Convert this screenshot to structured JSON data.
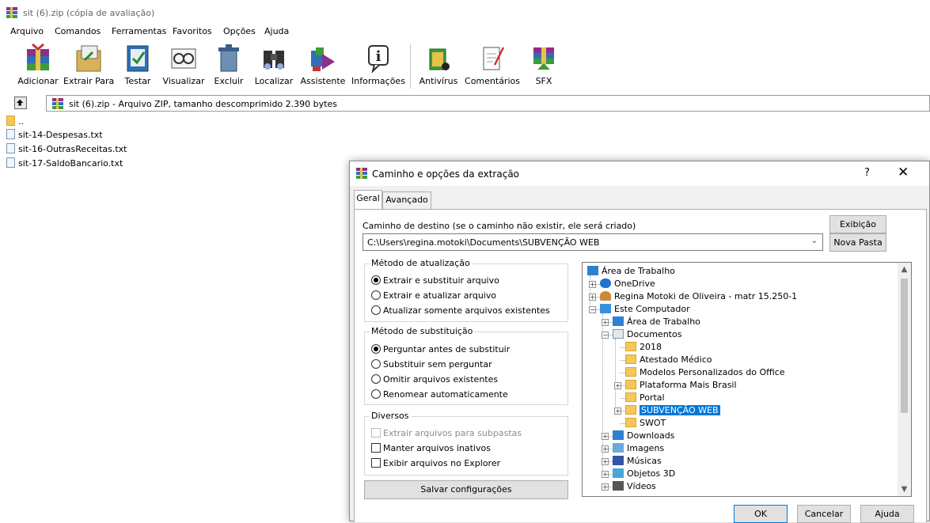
{
  "window": {
    "title": "sit (6).zip (cópia de avaliação)"
  },
  "menu": [
    "Arquivo",
    "Comandos",
    "Ferramentas",
    "Favoritos",
    "Opções",
    "Ajuda"
  ],
  "toolbar": [
    {
      "label": "Adicionar",
      "icon": "add-archive-icon"
    },
    {
      "label": "Extrair Para",
      "icon": "extract-to-icon"
    },
    {
      "label": "Testar",
      "icon": "test-icon"
    },
    {
      "label": "Visualizar",
      "icon": "view-icon"
    },
    {
      "label": "Excluir",
      "icon": "delete-icon"
    },
    {
      "label": "Localizar",
      "icon": "find-icon"
    },
    {
      "label": "Assistente",
      "icon": "wizard-icon"
    },
    {
      "label": "Informações",
      "icon": "info-icon"
    },
    {
      "label": "Antivírus",
      "icon": "antivirus-icon"
    },
    {
      "label": "Comentários",
      "icon": "comment-icon"
    },
    {
      "label": "SFX",
      "icon": "sfx-icon"
    }
  ],
  "address": {
    "text": "sit (6).zip - Arquivo ZIP, tamanho descomprimido 2.390 bytes"
  },
  "files": [
    {
      "name": "..",
      "kind": "folder"
    },
    {
      "name": "sit-14-Despesas.txt",
      "kind": "txt"
    },
    {
      "name": "sit-16-OutrasReceitas.txt",
      "kind": "txt"
    },
    {
      "name": "sit-17-SaldoBancario.txt",
      "kind": "txt"
    }
  ],
  "dialog": {
    "title": "Caminho e opções da extração",
    "help": "?",
    "close": "✕",
    "tabs": [
      "Geral",
      "Avançado"
    ],
    "dest_label": "Caminho de destino (se o caminho não existir, ele será criado)",
    "dest_value": "C:\\Users\\regina.motoki\\Documents\\SUBVENÇÃO WEB",
    "display_button": "Exibição",
    "new_folder_button": "Nova Pasta",
    "update_group": {
      "title": "Método de atualização",
      "options": [
        "Extrair e substituir arquivo",
        "Extrair e atualizar arquivo",
        "Atualizar somente arquivos existentes"
      ],
      "selected": 0
    },
    "overwrite_group": {
      "title": "Método de substituição",
      "options": [
        "Perguntar antes de substituir",
        "Substituir sem perguntar",
        "Omitir arquivos existentes",
        "Renomear automaticamente"
      ],
      "selected": 0
    },
    "misc_group": {
      "title": "Diversos",
      "options": [
        {
          "label": "Extrair arquivos para subpastas",
          "checked": false,
          "disabled": true
        },
        {
          "label": "Manter arquivos inativos",
          "checked": false,
          "disabled": false
        },
        {
          "label": "Exibir arquivos no Explorer",
          "checked": false,
          "disabled": false
        }
      ]
    },
    "save_button": "Salvar configurações",
    "tree": [
      {
        "label": "Área de Trabalho",
        "level": 0,
        "icon": "desktop-icon",
        "exp": ""
      },
      {
        "label": "OneDrive",
        "level": 1,
        "icon": "cloud-icon",
        "exp": "+"
      },
      {
        "label": "Regina Motoki de Oliveira - matr 15.250-1",
        "level": 1,
        "icon": "user-icon",
        "exp": "+"
      },
      {
        "label": "Este Computador",
        "level": 1,
        "icon": "computer-icon",
        "exp": "-"
      },
      {
        "label": "Área de Trabalho",
        "level": 2,
        "icon": "desktop-icon",
        "exp": "+"
      },
      {
        "label": "Documentos",
        "level": 2,
        "icon": "documents-icon",
        "exp": "-"
      },
      {
        "label": "2018",
        "level": 3,
        "icon": "folder-icon",
        "exp": ""
      },
      {
        "label": "Atestado Médico",
        "level": 3,
        "icon": "folder-icon",
        "exp": ""
      },
      {
        "label": "Modelos Personalizados do Office",
        "level": 3,
        "icon": "folder-icon",
        "exp": ""
      },
      {
        "label": "Plataforma Mais Brasil",
        "level": 3,
        "icon": "folder-icon",
        "exp": "+"
      },
      {
        "label": "Portal",
        "level": 3,
        "icon": "folder-icon",
        "exp": ""
      },
      {
        "label": "SUBVENÇÃO WEB",
        "level": 3,
        "icon": "folder-icon",
        "exp": "+",
        "selected": true
      },
      {
        "label": "SWOT",
        "level": 3,
        "icon": "folder-icon",
        "exp": ""
      },
      {
        "label": "Downloads",
        "level": 2,
        "icon": "download-icon",
        "exp": "+"
      },
      {
        "label": "Imagens",
        "level": 2,
        "icon": "images-icon",
        "exp": "+"
      },
      {
        "label": "Músicas",
        "level": 2,
        "icon": "music-icon",
        "exp": "+"
      },
      {
        "label": "Objetos 3D",
        "level": 2,
        "icon": "3d-objects-icon",
        "exp": "+"
      },
      {
        "label": "Vídeos",
        "level": 2,
        "icon": "videos-icon",
        "exp": "+"
      }
    ],
    "ok_button": "OK",
    "cancel_button": "Cancelar",
    "help_button": "Ajuda"
  }
}
